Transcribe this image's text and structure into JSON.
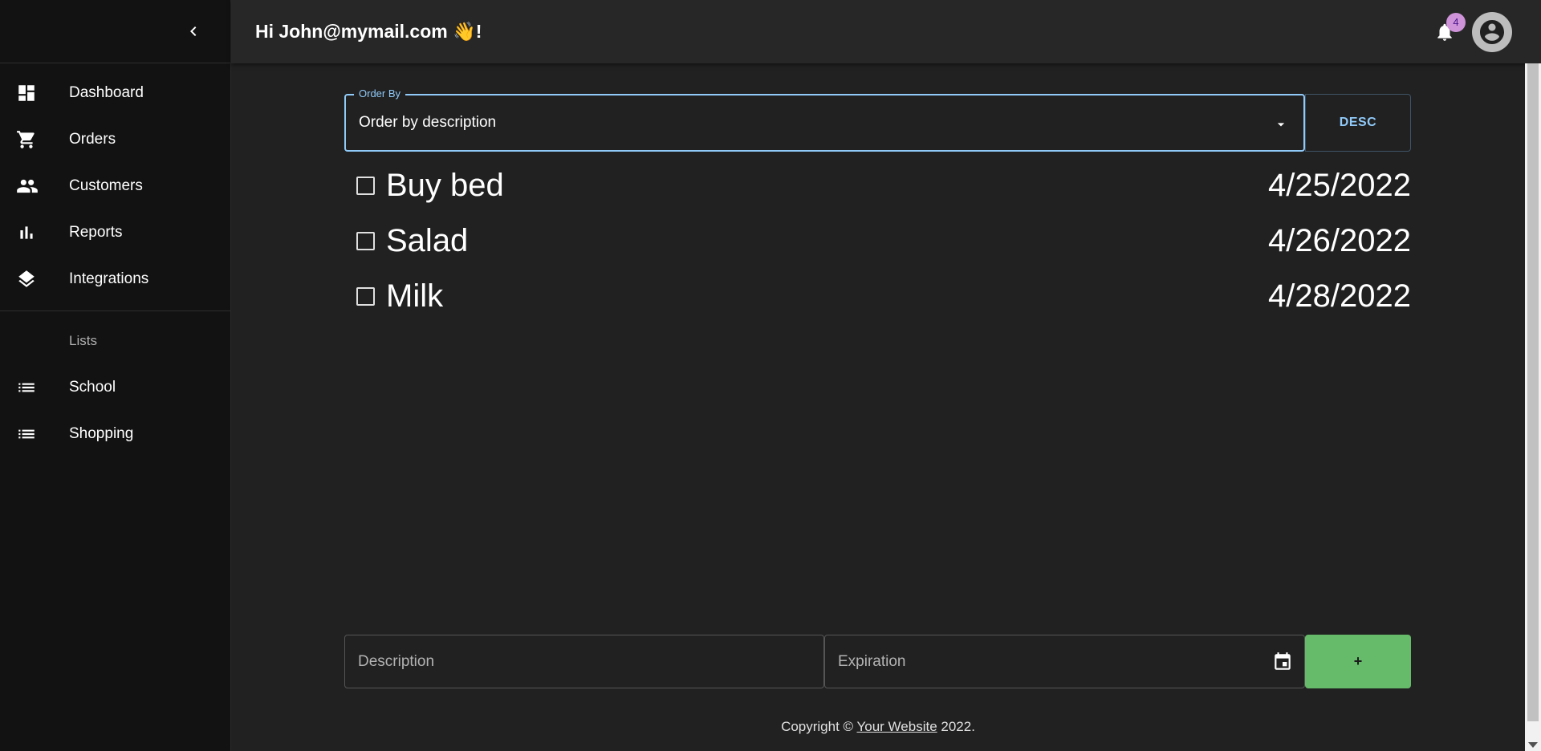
{
  "header": {
    "greeting": "Hi John@mymail.com 👋!",
    "notification_count": "4"
  },
  "sidebar": {
    "items": [
      {
        "label": "Dashboard",
        "icon": "dashboard-icon"
      },
      {
        "label": "Orders",
        "icon": "cart-icon"
      },
      {
        "label": "Customers",
        "icon": "people-icon"
      },
      {
        "label": "Reports",
        "icon": "bar-chart-icon"
      },
      {
        "label": "Integrations",
        "icon": "layers-icon"
      }
    ],
    "lists_header": "Lists",
    "lists": [
      {
        "label": "School",
        "icon": "list-icon"
      },
      {
        "label": "Shopping",
        "icon": "list-icon"
      }
    ]
  },
  "order": {
    "legend": "Order By",
    "value": "Order by description",
    "direction_label": "DESC"
  },
  "items": [
    {
      "description": "Buy bed",
      "date": "4/25/2022",
      "checked": false
    },
    {
      "description": "Salad",
      "date": "4/26/2022",
      "checked": false
    },
    {
      "description": "Milk",
      "date": "4/28/2022",
      "checked": false
    }
  ],
  "form": {
    "description_placeholder": "Description",
    "expiration_placeholder": "Expiration",
    "add_label": "+"
  },
  "footer": {
    "prefix": "Copyright © ",
    "link_text": "Your Website",
    "suffix": " 2022."
  },
  "colors": {
    "accent": "#90caf9",
    "add_button": "#66bb6a",
    "badge": "#ce93d8",
    "background": "#212121",
    "sidebar": "#121212"
  }
}
